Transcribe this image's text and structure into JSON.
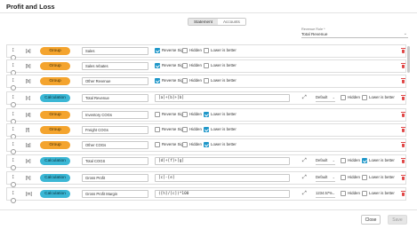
{
  "title": "Profit and Loss",
  "view_toggle": {
    "statement": "Statement",
    "accounts": "Accounts"
  },
  "reverse_role": {
    "label": "Revenue Role *",
    "value": "Total Revenue"
  },
  "labels": {
    "reverse_sign": "Reverse Sign",
    "hidden": "Hidden",
    "lower_is_better": "Lower is better"
  },
  "rows": [
    {
      "var": "[a]",
      "type": "Group",
      "name": "Sales",
      "reverse_sign": true,
      "hidden": false,
      "lower_is_better": false
    },
    {
      "var": "[b]",
      "type": "Group",
      "name": "Sales rebates",
      "reverse_sign": true,
      "hidden": false,
      "lower_is_better": false
    },
    {
      "var": "[b]",
      "type": "Group",
      "name": "Other Revenue",
      "reverse_sign": true,
      "hidden": false,
      "lower_is_better": false
    },
    {
      "var": "[c]",
      "type": "Calculation",
      "name": "Total Revenue",
      "formula": "[a]+[b]+[b]",
      "format": "Default",
      "hidden": false,
      "lower_is_better": false
    },
    {
      "var": "[d]",
      "type": "Group",
      "name": "Inventory COGs",
      "reverse_sign": false,
      "hidden": false,
      "lower_is_better": true
    },
    {
      "var": "[f]",
      "type": "Group",
      "name": "Freight COGs",
      "reverse_sign": false,
      "hidden": false,
      "lower_is_better": true
    },
    {
      "var": "[g]",
      "type": "Group",
      "name": "Other COGs",
      "reverse_sign": false,
      "hidden": false,
      "lower_is_better": true
    },
    {
      "var": "[e]",
      "type": "Calculation",
      "name": "Total COGS",
      "formula": "[d]+[f]+[g]",
      "format": "Default",
      "hidden": false,
      "lower_is_better": true
    },
    {
      "var": "[h]",
      "type": "Calculation",
      "name": "Gross Profit",
      "formula": "[c]-[e]",
      "format": "Default",
      "hidden": false,
      "lower_is_better": false
    },
    {
      "var": "[m]",
      "type": "Calculation",
      "name": "Gross Profit Margin",
      "formula": "([h]/[c])*100",
      "format": "1234.57%",
      "hidden": false,
      "lower_is_better": false
    }
  ],
  "footer": {
    "close": "Close",
    "save": "Save"
  },
  "colors": {
    "group": "#f4a42e",
    "calculation": "#3bb7d5",
    "checkbox_on": "#1f97c9",
    "delete": "#e04848"
  }
}
